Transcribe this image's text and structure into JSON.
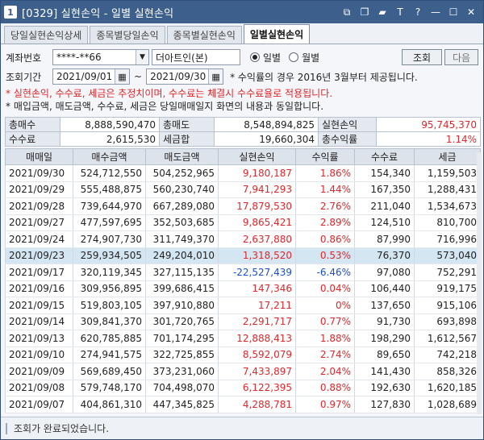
{
  "title": {
    "num": "1",
    "text": "[0329] 실현손익 - 일별 실현손익"
  },
  "title_icons": [
    "link-icon",
    "copy-icon",
    "pin-icon",
    "font-size-icon",
    "help-icon",
    "minimize-icon",
    "maximize-icon",
    "close-icon"
  ],
  "title_glyphs": {
    "font": "T",
    "help": "?"
  },
  "tabs": [
    {
      "label": "당일실현손익상세",
      "active": false
    },
    {
      "label": "종목별당일손익",
      "active": false
    },
    {
      "label": "종목별실현손익",
      "active": false
    },
    {
      "label": "일별실현손익",
      "active": true
    }
  ],
  "form": {
    "account_label": "계좌번호",
    "account_value": "****-**66",
    "account_name": "더아트인(본)",
    "radio_daily": "일별",
    "radio_monthly": "월별",
    "query_button": "조회",
    "next_button": "다음",
    "period_label": "조회기간",
    "date_from": "2021/09/01",
    "date_sep": "~",
    "date_to": "2021/09/30",
    "period_note": "* 수익률의 경우 2016년 3월부터 제공됩니다."
  },
  "notes": {
    "warning": "* 실현손익, 수수료, 세금은 추정치이며, 수수료는 체결시 수수료율로 적용됩니다.",
    "info": "* 매입금액, 매도금액, 수수료, 세금은 당일매매일지 화면의 내용과 동일합니다."
  },
  "summary": {
    "total_buy_label": "총매수",
    "total_buy": "8,888,590,470",
    "total_sell_label": "총매도",
    "total_sell": "8,548,894,825",
    "realized_label": "실현손익",
    "realized": "95,745,370",
    "fee_label": "수수료",
    "fee": "2,615,530",
    "tax_label": "세금합",
    "tax": "19,660,304",
    "return_label": "총수익률",
    "return": "1.14%"
  },
  "grid": {
    "headers": [
      "매매일",
      "매수금액",
      "매도금액",
      "실현손익",
      "수익률",
      "수수료",
      "세금"
    ],
    "rows": [
      {
        "date": "2021/09/30",
        "buy": "524,712,550",
        "sell": "504,252,965",
        "pnl": "9,180,187",
        "rate": "1.86%",
        "fee": "154,340",
        "tax": "1,159,503",
        "sign": "pos",
        "selected": false
      },
      {
        "date": "2021/09/29",
        "buy": "555,488,875",
        "sell": "560,230,740",
        "pnl": "7,941,293",
        "rate": "1.44%",
        "fee": "167,350",
        "tax": "1,288,431",
        "sign": "pos",
        "selected": false
      },
      {
        "date": "2021/09/28",
        "buy": "739,644,970",
        "sell": "667,289,080",
        "pnl": "17,879,530",
        "rate": "2.76%",
        "fee": "211,040",
        "tax": "1,534,673",
        "sign": "pos",
        "selected": false
      },
      {
        "date": "2021/09/27",
        "buy": "477,597,695",
        "sell": "352,503,685",
        "pnl": "9,865,421",
        "rate": "2.89%",
        "fee": "124,510",
        "tax": "810,700",
        "sign": "pos",
        "selected": false
      },
      {
        "date": "2021/09/24",
        "buy": "274,907,730",
        "sell": "311,749,370",
        "pnl": "2,637,880",
        "rate": "0.86%",
        "fee": "87,990",
        "tax": "716,996",
        "sign": "pos",
        "selected": false
      },
      {
        "date": "2021/09/23",
        "buy": "259,934,505",
        "sell": "249,204,010",
        "pnl": "1,318,520",
        "rate": "0.53%",
        "fee": "76,370",
        "tax": "573,040",
        "sign": "pos",
        "selected": true
      },
      {
        "date": "2021/09/17",
        "buy": "320,119,345",
        "sell": "327,115,135",
        "pnl": "-22,527,439",
        "rate": "-6.46%",
        "fee": "97,080",
        "tax": "752,291",
        "sign": "neg",
        "selected": false
      },
      {
        "date": "2021/09/16",
        "buy": "309,956,895",
        "sell": "399,686,415",
        "pnl": "147,346",
        "rate": "0.04%",
        "fee": "106,440",
        "tax": "919,175",
        "sign": "pos",
        "selected": false
      },
      {
        "date": "2021/09/15",
        "buy": "519,803,105",
        "sell": "397,910,880",
        "pnl": "17,211",
        "rate": "0%",
        "fee": "137,650",
        "tax": "915,106",
        "sign": "pos",
        "selected": false
      },
      {
        "date": "2021/09/14",
        "buy": "309,841,370",
        "sell": "301,720,765",
        "pnl": "2,291,717",
        "rate": "0.77%",
        "fee": "91,730",
        "tax": "693,898",
        "sign": "pos",
        "selected": false
      },
      {
        "date": "2021/09/13",
        "buy": "620,785,885",
        "sell": "701,174,295",
        "pnl": "12,888,413",
        "rate": "1.88%",
        "fee": "198,290",
        "tax": "1,612,567",
        "sign": "pos",
        "selected": false
      },
      {
        "date": "2021/09/10",
        "buy": "274,941,575",
        "sell": "322,725,855",
        "pnl": "8,592,079",
        "rate": "2.74%",
        "fee": "89,650",
        "tax": "742,218",
        "sign": "pos",
        "selected": false
      },
      {
        "date": "2021/09/09",
        "buy": "569,689,450",
        "sell": "373,231,060",
        "pnl": "7,433,897",
        "rate": "2.04%",
        "fee": "141,430",
        "tax": "858,326",
        "sign": "pos",
        "selected": false
      },
      {
        "date": "2021/09/08",
        "buy": "579,748,170",
        "sell": "704,498,070",
        "pnl": "6,122,395",
        "rate": "0.88%",
        "fee": "192,630",
        "tax": "1,620,185",
        "sign": "pos",
        "selected": false
      },
      {
        "date": "2021/09/07",
        "buy": "404,861,310",
        "sell": "447,345,825",
        "pnl": "4,288,781",
        "rate": "0.97%",
        "fee": "127,830",
        "tax": "1,028,689",
        "sign": "pos",
        "selected": false
      }
    ]
  },
  "status": {
    "text": "조회가 완료되었습니다."
  },
  "colors": {
    "titlebar": "#3d5f8c",
    "positive": "#e0262a",
    "negative": "#1f4fd1",
    "selected_row": "#d5e6f3"
  }
}
